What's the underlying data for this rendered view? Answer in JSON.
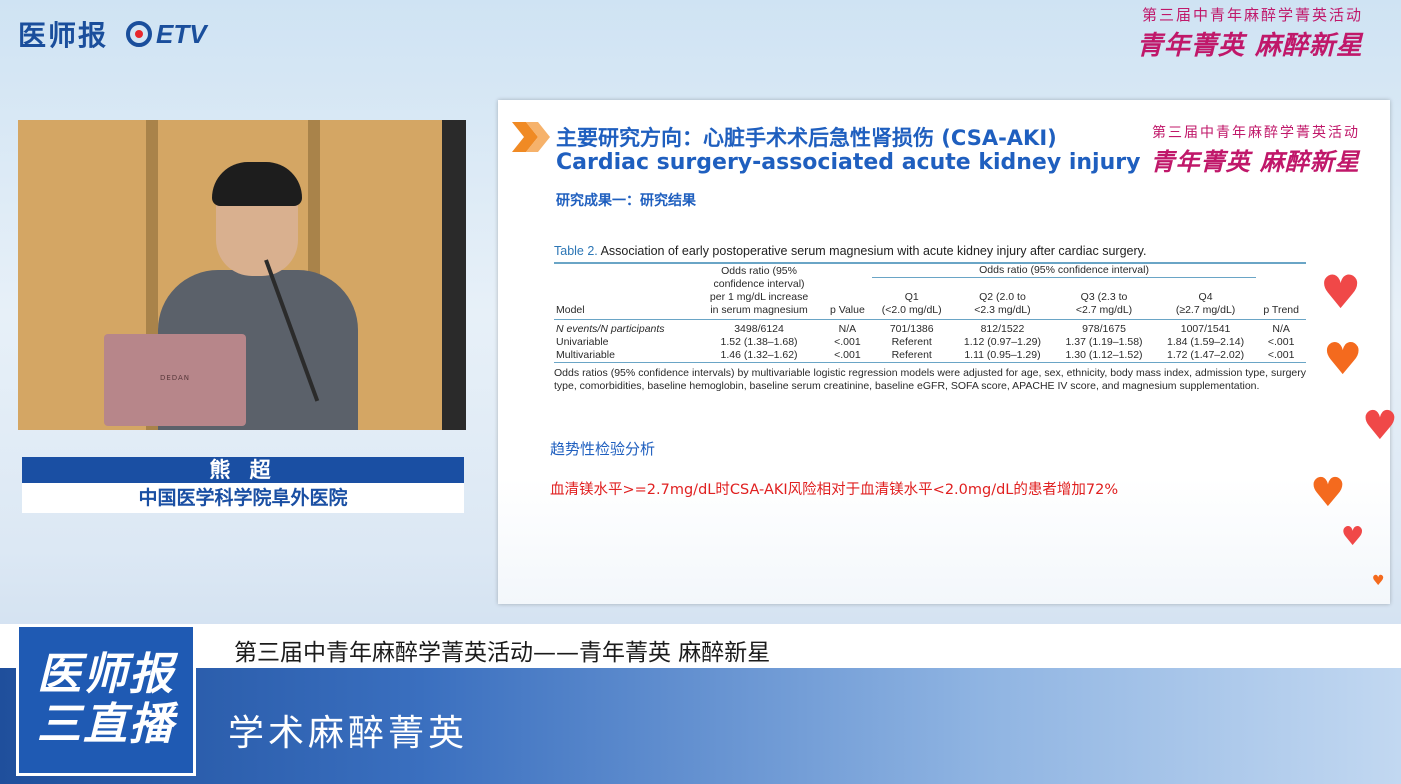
{
  "brand": {
    "yishibao": "医师报",
    "etv": "ETV"
  },
  "event": {
    "title_small": "第三届中青年麻醉学菁英活动",
    "title_big_1": "青年菁英",
    "title_big_2": "麻醉新星"
  },
  "speaker": {
    "name": "熊 超",
    "affiliation": "中国医学科学院阜外医院",
    "laptop_brand": "DEDAN"
  },
  "slide": {
    "title_cn": "主要研究方向：心脏手术术后急性肾损伤 (CSA-AKI)",
    "title_en": "Cardiac surgery-associated acute kidney injury",
    "subtitle": "研究成果一：研究结果",
    "table": {
      "label": "Table 2.",
      "caption": "Association of early postoperative serum magnesium with acute kidney injury after cardiac surgery.",
      "col_model": "Model",
      "col_or": [
        "Odds ratio (95%",
        "confidence interval)",
        "per 1 mg/dL increase",
        "in serum magnesium"
      ],
      "col_p": "p Value",
      "group_header": "Odds ratio (95% confidence interval)",
      "quartiles": [
        {
          "name": "Q1",
          "range": "(<2.0 mg/dL)"
        },
        {
          "name": "Q2 (2.0 to",
          "range": "<2.3 mg/dL)"
        },
        {
          "name": "Q3 (2.3 to",
          "range": "<2.7 mg/dL)"
        },
        {
          "name": "Q4",
          "range": "(≥2.7 mg/dL)"
        }
      ],
      "col_trend": "p Trend",
      "rows": [
        {
          "model": "N events/N participants",
          "or": "3498/6124",
          "p": "N/A",
          "q1": "701/1386",
          "q2": "812/1522",
          "q3": "978/1675",
          "q4": "1007/1541",
          "trend": "N/A"
        },
        {
          "model": "Univariable",
          "or": "1.52 (1.38–1.68)",
          "p": "<.001",
          "q1": "Referent",
          "q2": "1.12 (0.97–1.29)",
          "q3": "1.37 (1.19–1.58)",
          "q4": "1.84 (1.59–2.14)",
          "trend": "<.001"
        },
        {
          "model": "Multivariable",
          "or": "1.46 (1.32–1.62)",
          "p": "<.001",
          "q1": "Referent",
          "q2": "1.11 (0.95–1.29)",
          "q3": "1.30 (1.12–1.52)",
          "q4": "1.72 (1.47–2.02)",
          "trend": "<.001"
        }
      ],
      "footnote": "Odds ratios (95% confidence intervals) by multivariable logistic regression models were adjusted for age, sex, ethnicity, body mass index, admission type, surgery type, comorbidities, baseline hemoglobin, baseline serum creatinine, baseline eGFR, SOFA score, APACHE IV score, and magnesium supplementation."
    },
    "trend_title": "趋势性检验分析",
    "conclusion": "血清镁水平>=2.7mg/dL时CSA-AKI风险相对于血清镁水平<2.0mg/dL的患者增加72%"
  },
  "bottom": {
    "event_line": "第三届中青年麻醉学菁英活动——青年菁英  麻醉新星",
    "logo_line1": "医师报",
    "logo_line2": "三直播",
    "program": "学术麻醉菁英"
  },
  "colors": {
    "brand_blue": "#1a4e9c",
    "event_magenta": "#c0186a",
    "slide_blue": "#1f5fbf",
    "conclusion_red": "#e02020",
    "heart_red": "#f04848",
    "heart_orange": "#f46a1e"
  },
  "icons": [
    "logo-etv-icon",
    "slide-arrow-icon",
    "heart-icon"
  ]
}
